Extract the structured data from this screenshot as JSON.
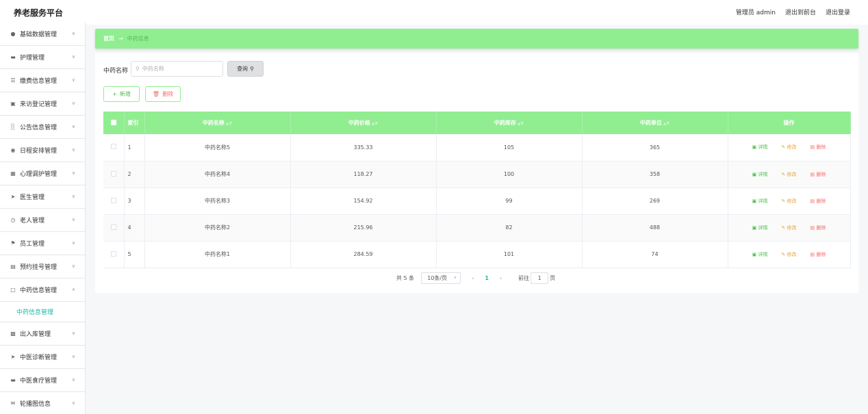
{
  "app": {
    "title": "养老服务平台"
  },
  "topbar": {
    "user": "管理员 admin",
    "to_front": "退出到前台",
    "logout": "退出登录"
  },
  "sidebar": {
    "items": [
      {
        "label": "基础数据管理",
        "icon": "user-icon"
      },
      {
        "label": "护理管理",
        "icon": "bed-icon"
      },
      {
        "label": "缴费信息管理",
        "icon": "list-icon"
      },
      {
        "label": "来访登记管理",
        "icon": "monitor-icon"
      },
      {
        "label": "公告信息管理",
        "icon": "chart-icon"
      },
      {
        "label": "日程安排管理",
        "icon": "location-icon"
      },
      {
        "label": "心理调护管理",
        "icon": "clipboard-icon"
      },
      {
        "label": "医生管理",
        "icon": "send-icon"
      },
      {
        "label": "老人管理",
        "icon": "compass-icon"
      },
      {
        "label": "员工管理",
        "icon": "flag-icon"
      },
      {
        "label": "预约挂号管理",
        "icon": "document-icon"
      },
      {
        "label": "中药信息管理",
        "icon": "copy-icon"
      },
      {
        "label": "出入库管理",
        "icon": "grid-icon"
      },
      {
        "label": "中医诊断管理",
        "icon": "arrow-icon"
      },
      {
        "label": "中医食疗管理",
        "icon": "ticket-icon"
      },
      {
        "label": "轮播图信息",
        "icon": "mail-icon"
      }
    ],
    "active_sub": "中药信息管理"
  },
  "breadcrumb": {
    "home": "首页",
    "arrow": "→",
    "current": "中药信息"
  },
  "search": {
    "label": "中药名称",
    "placeholder": "中药名称",
    "button": "查询"
  },
  "actions": {
    "add": "新增",
    "delete": "删除"
  },
  "table": {
    "columns": [
      "索引",
      "中药名称",
      "中药价格",
      "中药库存",
      "中药单位",
      "操作"
    ],
    "rows": [
      {
        "index": "1",
        "name": "中药名称5",
        "price": "335.33",
        "stock": "105",
        "unit": "365"
      },
      {
        "index": "2",
        "name": "中药名称4",
        "price": "118.27",
        "stock": "100",
        "unit": "358"
      },
      {
        "index": "3",
        "name": "中药名称3",
        "price": "154.92",
        "stock": "99",
        "unit": "269"
      },
      {
        "index": "4",
        "name": "中药名称2",
        "price": "215.96",
        "stock": "82",
        "unit": "488"
      },
      {
        "index": "5",
        "name": "中药名称1",
        "price": "284.59",
        "stock": "101",
        "unit": "74"
      }
    ],
    "row_actions": {
      "detail": "详情",
      "edit": "修改",
      "remove": "删除"
    }
  },
  "pagination": {
    "total": "共 5 条",
    "page_size": "10条/页",
    "current": "1",
    "goto_label": "前往",
    "goto_value": "1",
    "page_unit": "页"
  },
  "colors": {
    "accent": "#90ee90",
    "active": "#1fb6a5",
    "danger": "#f56c6c",
    "warning": "#e6a23c"
  }
}
